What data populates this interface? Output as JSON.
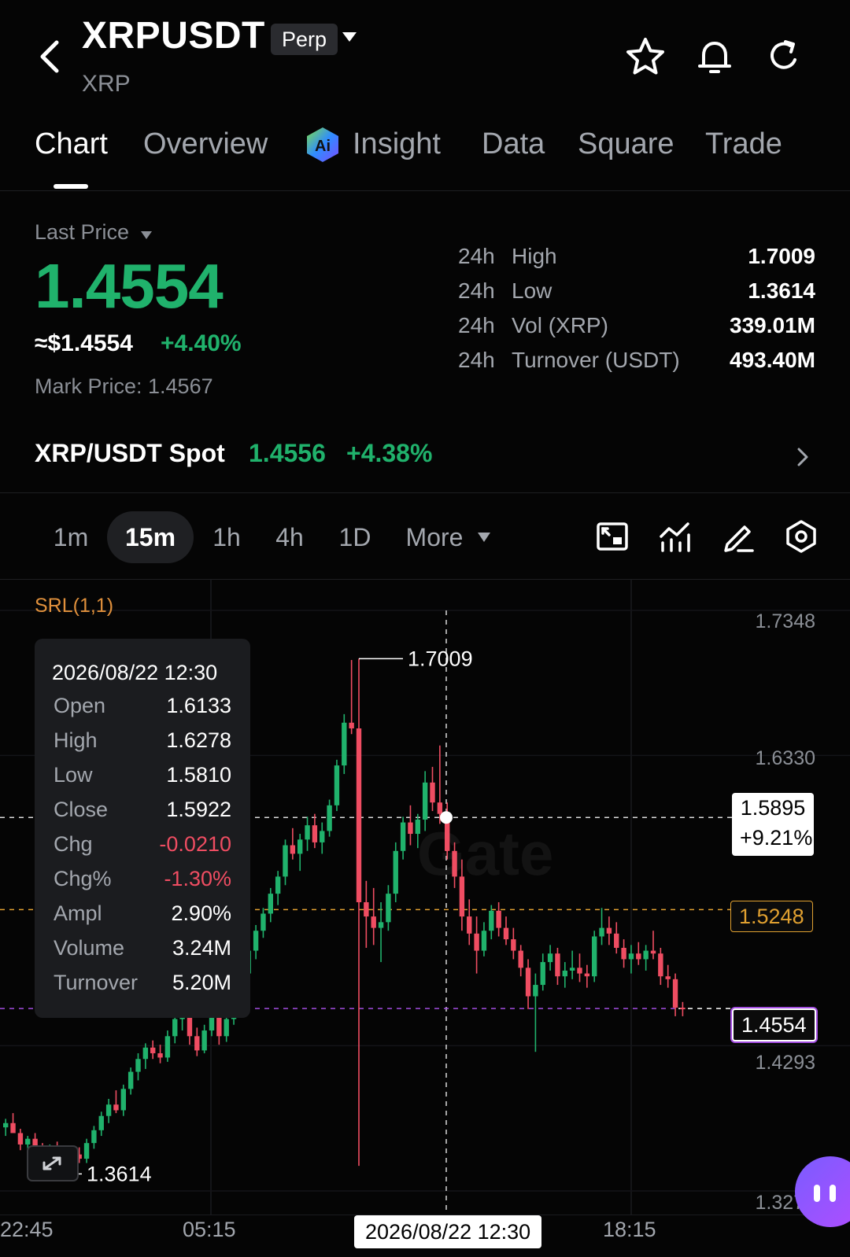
{
  "header": {
    "pair": "XRPUSDT",
    "badge": "Perp",
    "base_coin": "XRP",
    "icons": [
      "back-arrow-icon",
      "star-icon",
      "bell-icon",
      "refresh-icon"
    ]
  },
  "tabs": [
    {
      "label": "Chart",
      "active": true
    },
    {
      "label": "Overview"
    },
    {
      "label": "Insight",
      "icon": "ai-insight-icon"
    },
    {
      "label": "Data"
    },
    {
      "label": "Square"
    },
    {
      "label": "Trade"
    }
  ],
  "price": {
    "last_price_label": "Last Price",
    "last_price": "1.4554",
    "usd_price": "≈$1.4554",
    "change_pct": "+4.40%",
    "mark_price": "Mark Price: 1.4567"
  },
  "stats": [
    {
      "period": "24h",
      "name": "High",
      "value": "1.7009"
    },
    {
      "period": "24h",
      "name": "Low",
      "value": "1.3614"
    },
    {
      "period": "24h",
      "name": "Vol (XRP)",
      "value": "339.01M"
    },
    {
      "period": "24h",
      "name": "Turnover (USDT)",
      "value": "493.40M"
    }
  ],
  "spot": {
    "label": "XRP/USDT Spot",
    "price": "1.4556",
    "change": "+4.38%"
  },
  "timeframes": [
    {
      "label": "1m"
    },
    {
      "label": "15m",
      "active": true
    },
    {
      "label": "1h"
    },
    {
      "label": "4h"
    },
    {
      "label": "1D"
    },
    {
      "label": "More"
    }
  ],
  "tool_icons": [
    "chart-layout-icon",
    "indicator-icon",
    "draw-pencil-icon",
    "settings-hex-icon"
  ],
  "chart": {
    "indicator": "SRL(1,1)",
    "watermark": "Gate",
    "y_axis": [
      "1.7348",
      "1.6330",
      "1.4293",
      "1.3274"
    ],
    "x_axis": [
      "22:45",
      "05:15",
      "18:15"
    ],
    "crosshair_date": "2026/08/22 12:30",
    "crosshair_price": "1.5895",
    "crosshair_pct": "+9.21%",
    "level_price": "1.5248",
    "last_price_tag": "1.4554",
    "high_marker": "1.7009",
    "low_marker": "1.3614",
    "colors": {
      "up": "#20b26c",
      "down": "#ef4d62",
      "level": "#e0a030",
      "last": "#a24de0"
    }
  },
  "tooltip": {
    "date": "2026/08/22 12:30",
    "rows": [
      {
        "k": "Open",
        "v": "1.6133"
      },
      {
        "k": "High",
        "v": "1.6278"
      },
      {
        "k": "Low",
        "v": "1.5810"
      },
      {
        "k": "Close",
        "v": "1.5922"
      },
      {
        "k": "Chg",
        "v": "-0.0210",
        "color": "red"
      },
      {
        "k": "Chg%",
        "v": "-1.30%",
        "color": "red"
      },
      {
        "k": "Ampl",
        "v": "2.90%"
      },
      {
        "k": "Volume",
        "v": "3.24M"
      },
      {
        "k": "Turnover",
        "v": "5.20M"
      }
    ]
  },
  "chart_data": {
    "type": "candlestick",
    "interval": "15m",
    "ylim": [
      1.3274,
      1.7348
    ],
    "candles": [
      [
        1.372,
        1.378,
        1.366,
        1.375
      ],
      [
        1.375,
        1.382,
        1.37,
        1.368
      ],
      [
        1.368,
        1.371,
        1.356,
        1.36
      ],
      [
        1.36,
        1.366,
        1.35,
        1.364
      ],
      [
        1.364,
        1.368,
        1.352,
        1.356
      ],
      [
        1.356,
        1.361,
        1.345,
        1.352
      ],
      [
        1.352,
        1.36,
        1.346,
        1.358
      ],
      [
        1.358,
        1.362,
        1.348,
        1.351
      ],
      [
        1.351,
        1.357,
        1.346,
        1.349
      ],
      [
        1.349,
        1.355,
        1.343,
        1.353
      ],
      [
        1.353,
        1.358,
        1.347,
        1.35
      ],
      [
        1.35,
        1.364,
        1.347,
        1.361
      ],
      [
        1.361,
        1.373,
        1.357,
        1.37
      ],
      [
        1.37,
        1.383,
        1.366,
        1.38
      ],
      [
        1.38,
        1.392,
        1.375,
        1.388
      ],
      [
        1.388,
        1.398,
        1.382,
        1.384
      ],
      [
        1.384,
        1.402,
        1.38,
        1.399
      ],
      [
        1.399,
        1.414,
        1.395,
        1.411
      ],
      [
        1.411,
        1.424,
        1.405,
        1.42
      ],
      [
        1.42,
        1.431,
        1.413,
        1.428
      ],
      [
        1.428,
        1.433,
        1.42,
        1.424
      ],
      [
        1.424,
        1.43,
        1.417,
        1.421
      ],
      [
        1.421,
        1.44,
        1.418,
        1.436
      ],
      [
        1.436,
        1.452,
        1.431,
        1.448
      ],
      [
        1.448,
        1.462,
        1.44,
        1.456
      ],
      [
        1.456,
        1.462,
        1.43,
        1.436
      ],
      [
        1.436,
        1.442,
        1.422,
        1.426
      ],
      [
        1.426,
        1.444,
        1.424,
        1.44
      ],
      [
        1.44,
        1.458,
        1.436,
        1.452
      ],
      [
        1.452,
        1.456,
        1.43,
        1.436
      ],
      [
        1.436,
        1.452,
        1.432,
        1.448
      ],
      [
        1.448,
        1.472,
        1.444,
        1.468
      ],
      [
        1.468,
        1.484,
        1.462,
        1.48
      ],
      [
        1.48,
        1.5,
        1.475,
        1.496
      ],
      [
        1.496,
        1.514,
        1.49,
        1.51
      ],
      [
        1.51,
        1.526,
        1.505,
        1.522
      ],
      [
        1.522,
        1.54,
        1.516,
        1.536
      ],
      [
        1.536,
        1.552,
        1.528,
        1.548
      ],
      [
        1.548,
        1.574,
        1.542,
        1.57
      ],
      [
        1.57,
        1.582,
        1.56,
        1.564
      ],
      [
        1.564,
        1.578,
        1.552,
        1.574
      ],
      [
        1.574,
        1.59,
        1.566,
        1.584
      ],
      [
        1.584,
        1.592,
        1.568,
        1.572
      ],
      [
        1.572,
        1.586,
        1.564,
        1.58
      ],
      [
        1.58,
        1.602,
        1.576,
        1.598
      ],
      [
        1.598,
        1.63,
        1.594,
        1.626
      ],
      [
        1.626,
        1.662,
        1.62,
        1.656
      ],
      [
        1.656,
        1.7,
        1.648,
        1.652
      ],
      [
        1.652,
        1.701,
        1.345,
        1.53
      ],
      [
        1.53,
        1.545,
        1.498,
        1.52
      ],
      [
        1.52,
        1.54,
        1.5,
        1.512
      ],
      [
        1.512,
        1.53,
        1.488,
        1.516
      ],
      [
        1.516,
        1.542,
        1.51,
        1.536
      ],
      [
        1.536,
        1.572,
        1.53,
        1.566
      ],
      [
        1.566,
        1.59,
        1.56,
        1.586
      ],
      [
        1.586,
        1.598,
        1.57,
        1.578
      ],
      [
        1.578,
        1.592,
        1.568,
        1.588
      ],
      [
        1.588,
        1.622,
        1.58,
        1.614
      ],
      [
        1.614,
        1.625,
        1.594,
        1.6
      ],
      [
        1.6,
        1.64,
        1.585,
        1.592
      ],
      [
        1.592,
        1.6,
        1.56,
        1.566
      ],
      [
        1.566,
        1.572,
        1.54,
        1.548
      ],
      [
        1.548,
        1.56,
        1.51,
        1.52
      ],
      [
        1.52,
        1.532,
        1.5,
        1.508
      ],
      [
        1.508,
        1.52,
        1.48,
        1.496
      ],
      [
        1.496,
        1.516,
        1.492,
        1.51
      ],
      [
        1.51,
        1.528,
        1.504,
        1.524
      ],
      [
        1.524,
        1.53,
        1.506,
        1.512
      ],
      [
        1.512,
        1.52,
        1.5,
        1.504
      ],
      [
        1.504,
        1.512,
        1.49,
        1.496
      ],
      [
        1.496,
        1.5,
        1.478,
        1.484
      ],
      [
        1.484,
        1.49,
        1.455,
        1.464
      ],
      [
        1.464,
        1.48,
        1.425,
        1.472
      ],
      [
        1.472,
        1.494,
        1.468,
        1.488
      ],
      [
        1.488,
        1.5,
        1.482,
        1.494
      ],
      [
        1.494,
        1.498,
        1.472,
        1.478
      ],
      [
        1.478,
        1.488,
        1.47,
        1.482
      ],
      [
        1.482,
        1.496,
        1.476,
        1.484
      ],
      [
        1.484,
        1.494,
        1.474,
        1.48
      ],
      [
        1.48,
        1.486,
        1.47,
        1.478
      ],
      [
        1.478,
        1.51,
        1.474,
        1.506
      ],
      [
        1.506,
        1.526,
        1.5,
        1.512
      ],
      [
        1.512,
        1.52,
        1.5,
        1.508
      ],
      [
        1.508,
        1.516,
        1.494,
        1.498
      ],
      [
        1.498,
        1.504,
        1.484,
        1.49
      ],
      [
        1.49,
        1.5,
        1.48,
        1.494
      ],
      [
        1.494,
        1.502,
        1.486,
        1.49
      ],
      [
        1.49,
        1.5,
        1.482,
        1.496
      ],
      [
        1.496,
        1.51,
        1.49,
        1.494
      ],
      [
        1.494,
        1.498,
        1.472,
        1.478
      ],
      [
        1.478,
        1.486,
        1.47,
        1.476
      ],
      [
        1.476,
        1.48,
        1.45,
        1.456
      ],
      [
        1.456,
        1.46,
        1.45,
        1.455
      ]
    ]
  }
}
